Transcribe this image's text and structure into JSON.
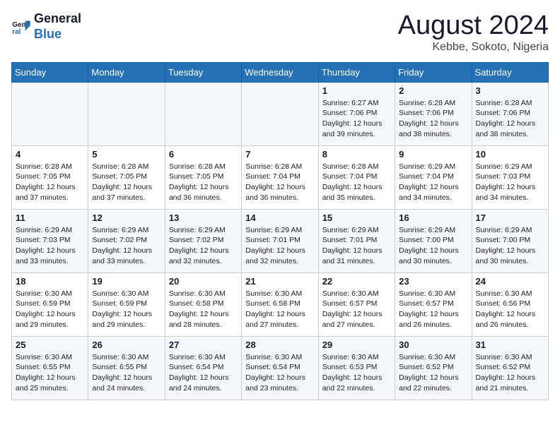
{
  "logo": {
    "line1": "General",
    "line2": "Blue"
  },
  "title": "August 2024",
  "location": "Kebbe, Sokoto, Nigeria",
  "days_of_week": [
    "Sunday",
    "Monday",
    "Tuesday",
    "Wednesday",
    "Thursday",
    "Friday",
    "Saturday"
  ],
  "weeks": [
    [
      {
        "day": "",
        "info": ""
      },
      {
        "day": "",
        "info": ""
      },
      {
        "day": "",
        "info": ""
      },
      {
        "day": "",
        "info": ""
      },
      {
        "day": "1",
        "info": "Sunrise: 6:27 AM\nSunset: 7:06 PM\nDaylight: 12 hours\nand 39 minutes."
      },
      {
        "day": "2",
        "info": "Sunrise: 6:28 AM\nSunset: 7:06 PM\nDaylight: 12 hours\nand 38 minutes."
      },
      {
        "day": "3",
        "info": "Sunrise: 6:28 AM\nSunset: 7:06 PM\nDaylight: 12 hours\nand 38 minutes."
      }
    ],
    [
      {
        "day": "4",
        "info": "Sunrise: 6:28 AM\nSunset: 7:05 PM\nDaylight: 12 hours\nand 37 minutes."
      },
      {
        "day": "5",
        "info": "Sunrise: 6:28 AM\nSunset: 7:05 PM\nDaylight: 12 hours\nand 37 minutes."
      },
      {
        "day": "6",
        "info": "Sunrise: 6:28 AM\nSunset: 7:05 PM\nDaylight: 12 hours\nand 36 minutes."
      },
      {
        "day": "7",
        "info": "Sunrise: 6:28 AM\nSunset: 7:04 PM\nDaylight: 12 hours\nand 36 minutes."
      },
      {
        "day": "8",
        "info": "Sunrise: 6:28 AM\nSunset: 7:04 PM\nDaylight: 12 hours\nand 35 minutes."
      },
      {
        "day": "9",
        "info": "Sunrise: 6:29 AM\nSunset: 7:04 PM\nDaylight: 12 hours\nand 34 minutes."
      },
      {
        "day": "10",
        "info": "Sunrise: 6:29 AM\nSunset: 7:03 PM\nDaylight: 12 hours\nand 34 minutes."
      }
    ],
    [
      {
        "day": "11",
        "info": "Sunrise: 6:29 AM\nSunset: 7:03 PM\nDaylight: 12 hours\nand 33 minutes."
      },
      {
        "day": "12",
        "info": "Sunrise: 6:29 AM\nSunset: 7:02 PM\nDaylight: 12 hours\nand 33 minutes."
      },
      {
        "day": "13",
        "info": "Sunrise: 6:29 AM\nSunset: 7:02 PM\nDaylight: 12 hours\nand 32 minutes."
      },
      {
        "day": "14",
        "info": "Sunrise: 6:29 AM\nSunset: 7:01 PM\nDaylight: 12 hours\nand 32 minutes."
      },
      {
        "day": "15",
        "info": "Sunrise: 6:29 AM\nSunset: 7:01 PM\nDaylight: 12 hours\nand 31 minutes."
      },
      {
        "day": "16",
        "info": "Sunrise: 6:29 AM\nSunset: 7:00 PM\nDaylight: 12 hours\nand 30 minutes."
      },
      {
        "day": "17",
        "info": "Sunrise: 6:29 AM\nSunset: 7:00 PM\nDaylight: 12 hours\nand 30 minutes."
      }
    ],
    [
      {
        "day": "18",
        "info": "Sunrise: 6:30 AM\nSunset: 6:59 PM\nDaylight: 12 hours\nand 29 minutes."
      },
      {
        "day": "19",
        "info": "Sunrise: 6:30 AM\nSunset: 6:59 PM\nDaylight: 12 hours\nand 29 minutes."
      },
      {
        "day": "20",
        "info": "Sunrise: 6:30 AM\nSunset: 6:58 PM\nDaylight: 12 hours\nand 28 minutes."
      },
      {
        "day": "21",
        "info": "Sunrise: 6:30 AM\nSunset: 6:58 PM\nDaylight: 12 hours\nand 27 minutes."
      },
      {
        "day": "22",
        "info": "Sunrise: 6:30 AM\nSunset: 6:57 PM\nDaylight: 12 hours\nand 27 minutes."
      },
      {
        "day": "23",
        "info": "Sunrise: 6:30 AM\nSunset: 6:57 PM\nDaylight: 12 hours\nand 26 minutes."
      },
      {
        "day": "24",
        "info": "Sunrise: 6:30 AM\nSunset: 6:56 PM\nDaylight: 12 hours\nand 26 minutes."
      }
    ],
    [
      {
        "day": "25",
        "info": "Sunrise: 6:30 AM\nSunset: 6:55 PM\nDaylight: 12 hours\nand 25 minutes."
      },
      {
        "day": "26",
        "info": "Sunrise: 6:30 AM\nSunset: 6:55 PM\nDaylight: 12 hours\nand 24 minutes."
      },
      {
        "day": "27",
        "info": "Sunrise: 6:30 AM\nSunset: 6:54 PM\nDaylight: 12 hours\nand 24 minutes."
      },
      {
        "day": "28",
        "info": "Sunrise: 6:30 AM\nSunset: 6:54 PM\nDaylight: 12 hours\nand 23 minutes."
      },
      {
        "day": "29",
        "info": "Sunrise: 6:30 AM\nSunset: 6:53 PM\nDaylight: 12 hours\nand 22 minutes."
      },
      {
        "day": "30",
        "info": "Sunrise: 6:30 AM\nSunset: 6:52 PM\nDaylight: 12 hours\nand 22 minutes."
      },
      {
        "day": "31",
        "info": "Sunrise: 6:30 AM\nSunset: 6:52 PM\nDaylight: 12 hours\nand 21 minutes."
      }
    ]
  ]
}
